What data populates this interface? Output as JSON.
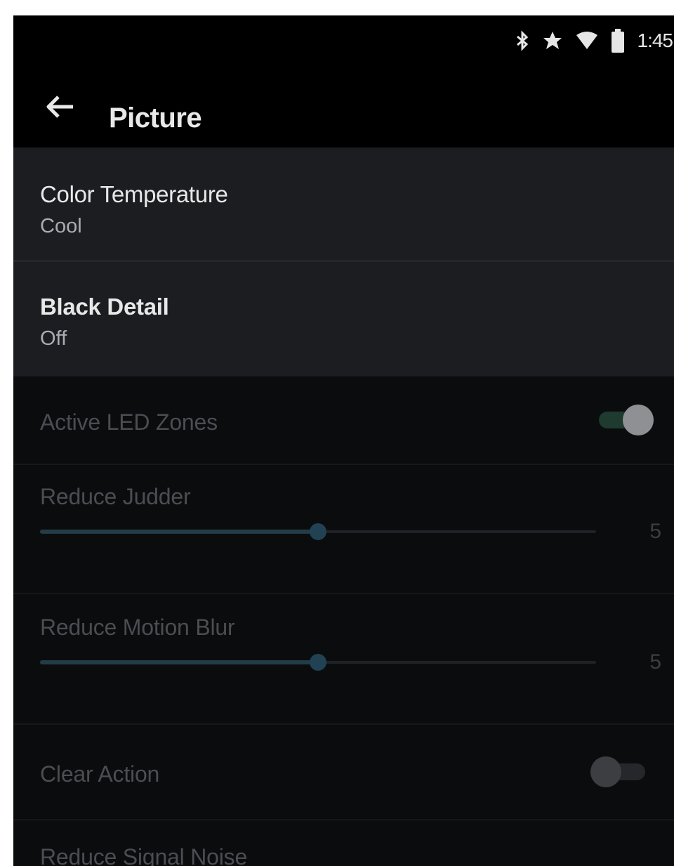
{
  "status_bar": {
    "time": "1:45",
    "icons": [
      "bluetooth-icon",
      "star-icon",
      "wifi-icon",
      "battery-icon"
    ]
  },
  "app_bar": {
    "back_icon": "back-arrow-icon",
    "title": "Picture"
  },
  "settings": {
    "color_temperature": {
      "title": "Color Temperature",
      "value": "Cool"
    },
    "black_detail": {
      "title": "Black Detail",
      "value": "Off"
    },
    "active_led_zones": {
      "title": "Active LED Zones",
      "enabled": true,
      "disabled_state": true
    },
    "reduce_judder": {
      "title": "Reduce Judder",
      "value": "5",
      "min": 0,
      "max": 10
    },
    "reduce_motion_blur": {
      "title": "Reduce Motion Blur",
      "value": "5",
      "min": 0,
      "max": 10
    },
    "clear_action": {
      "title": "Clear Action",
      "enabled": false
    },
    "reduce_signal_noise": {
      "title": "Reduce Signal Noise"
    }
  },
  "colors": {
    "background": "#0b0c0e",
    "highlighted_row": "#1b1d21",
    "slider_accent": "#233c48",
    "dim_text": "#4a4d52"
  }
}
